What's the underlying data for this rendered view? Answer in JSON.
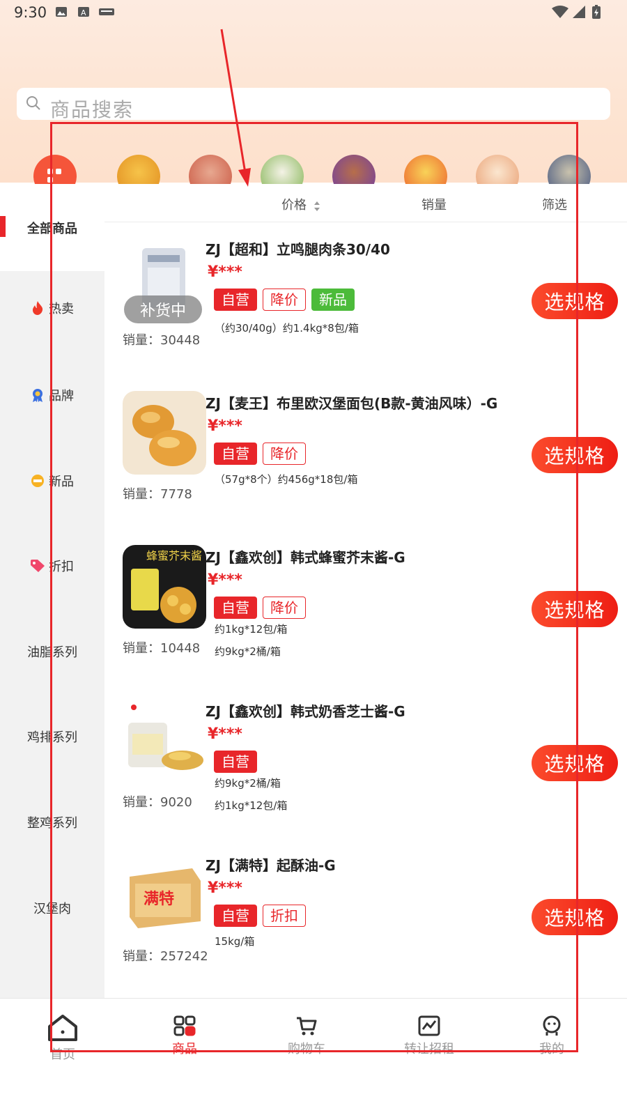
{
  "status_bar": {
    "time": "9:30"
  },
  "search": {
    "placeholder": "商品搜索"
  },
  "category_icons": [
    "apps-icon",
    "burger-icon",
    "salad-icon",
    "rice-icon",
    "skewer-icon",
    "fries-icon",
    "dessert-icon",
    "lunchbox-icon"
  ],
  "sidebar": {
    "items": [
      {
        "label": "全部商品",
        "icon": null,
        "active": true
      },
      {
        "label": "热卖",
        "icon": "fire-icon"
      },
      {
        "label": "品牌",
        "icon": "medal-icon"
      },
      {
        "label": "新品",
        "icon": "new-icon"
      },
      {
        "label": "折扣",
        "icon": "tag-icon"
      },
      {
        "label": "油脂系列",
        "icon": null
      },
      {
        "label": "鸡排系列",
        "icon": null
      },
      {
        "label": "整鸡系列",
        "icon": null
      },
      {
        "label": "汉堡肉",
        "icon": null
      }
    ]
  },
  "sort_bar": {
    "price": "价格",
    "sales": "销量",
    "filter": "筛选"
  },
  "products": [
    {
      "name": "ZJ【超和】立鸣腿肉条30/40",
      "price": "¥***",
      "tags": [
        "自营",
        "降价",
        "新品"
      ],
      "specs": [
        "（约30/40g）约1.4kg*8包/箱"
      ],
      "sales": "销量：30448",
      "button": "选规格",
      "restock": "补货中"
    },
    {
      "name": "ZJ【麦王】布里欧汉堡面包(B款-黄油风味）-G",
      "price": "¥***",
      "tags": [
        "自营",
        "降价"
      ],
      "specs": [
        "（57g*8个）约456g*18包/箱"
      ],
      "sales": "销量：7778",
      "button": "选规格"
    },
    {
      "name": "ZJ【鑫欢创】韩式蜂蜜芥末酱-G",
      "price": "¥***",
      "tags": [
        "自营",
        "降价"
      ],
      "specs": [
        "约1kg*12包/箱",
        "约9kg*2桶/箱"
      ],
      "sales": "销量：10448",
      "button": "选规格",
      "image_text": "蜂蜜芥末酱"
    },
    {
      "name": "ZJ【鑫欢创】韩式奶香芝士酱-G",
      "price": "¥***",
      "tags": [
        "自营"
      ],
      "specs": [
        "约9kg*2桶/箱",
        "约1kg*12包/箱"
      ],
      "sales": "销量：9020",
      "button": "选规格"
    },
    {
      "name": "ZJ【满特】起酥油-G",
      "price": "¥***",
      "tags": [
        "自营",
        "折扣"
      ],
      "specs": [
        "15kg/箱"
      ],
      "sales": "销量：257242",
      "button": "选规格",
      "image_text": "满特"
    }
  ],
  "tab_bar": [
    {
      "label": "首页",
      "icon": "home-icon"
    },
    {
      "label": "商品",
      "icon": "grid-icon",
      "active": true
    },
    {
      "label": "购物车",
      "icon": "cart-icon"
    },
    {
      "label": "转让招租",
      "icon": "chart-icon"
    },
    {
      "label": "我的",
      "icon": "profile-icon"
    }
  ],
  "colors": {
    "accent": "#e8262a",
    "new_tag": "#4cbb3a",
    "sidebar_bg": "#f2f2f2",
    "header_bg": "#fde4d2"
  }
}
